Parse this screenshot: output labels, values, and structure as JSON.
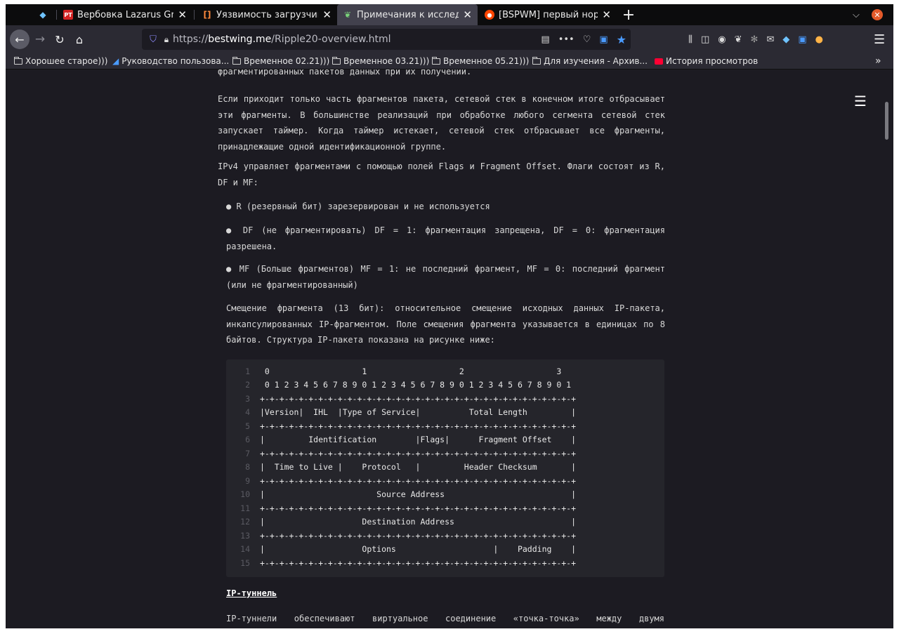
{
  "tabs": [
    {
      "label": "",
      "favicon": "sapphire-icon",
      "active": false
    },
    {
      "label": "Вербовка Lazarus Group",
      "favicon": "pt-icon",
      "active": false
    },
    {
      "label": "Уязвимость загрузчика",
      "favicon": "bracket-icon",
      "active": false
    },
    {
      "label": "Примечания к исследов",
      "favicon": "sprout-icon",
      "active": true
    },
    {
      "label": "[BSPWM] первый норд",
      "favicon": "reddit-icon",
      "active": false
    }
  ],
  "tab_close_glyph": "✕",
  "new_tab_glyph": "+",
  "address_bar": {
    "scheme": "https://",
    "host": "bestwing.me",
    "path": "/Ripple20-overview.html"
  },
  "bookmarks": [
    {
      "label": "Хорошее старое)))",
      "icon": "folder-icon"
    },
    {
      "label": "Руководство пользова...",
      "icon": "page-icon"
    },
    {
      "label": "Временное 02.21)))",
      "icon": "folder-icon"
    },
    {
      "label": "Временное 03.21)))",
      "icon": "folder-icon"
    },
    {
      "label": "Временное 05.21)))",
      "icon": "folder-icon"
    },
    {
      "label": "Для изучения - Архив...",
      "icon": "folder-icon"
    },
    {
      "label": "История просмотров",
      "icon": "youtube-icon"
    }
  ],
  "article": {
    "p0": "фрагментированных пакетов данных при их получении.",
    "p1": "Если приходит только часть фрагментов пакета, сетевой стек в конечном итоге отбрасывает эти фрагменты. В большинстве реализаций при обработке любого сегмента сетевой стек запускает таймер. Когда таймер истекает, сетевой стек отбрасывает все фрагменты, принадлежащие одной идентификационной группе.",
    "p2": "IPv4 управляет фрагментами с помощью полей Flags и Fragment Offset. Флаги состоят из R, DF и MF:",
    "b1": "● R (резервный бит) зарезервирован и не используется",
    "b2": "● DF (не фрагментировать) DF = 1: фрагментация запрещена, DF = 0: фрагментация разрешена.",
    "b3": "● MF (Больше фрагментов) MF = 1: не последний фрагмент, MF = 0: последний фрагмент (или не фрагментированный)",
    "p3": "Смещение фрагмента (13 бит): относительное смещение исходных данных IP-пакета, инкапсулированных IP-фрагментом. Поле смещения фрагмента указывается в единицах по 8 байтов. Структура IP-пакета показана на рисунке ниже:",
    "heading": "IP-туннель",
    "p4": "IP-туннели обеспечивают виртуальное соединение «точка-точка» между двумя"
  },
  "code_lines": [
    {
      "n": "1",
      "text": " 0                   1                   2                   3"
    },
    {
      "n": "2",
      "text": " 0 1 2 3 4 5 6 7 8 9 0 1 2 3 4 5 6 7 8 9 0 1 2 3 4 5 6 7 8 9 0 1"
    },
    {
      "n": "3",
      "text": "+-+-+-+-+-+-+-+-+-+-+-+-+-+-+-+-+-+-+-+-+-+-+-+-+-+-+-+-+-+-+-+-+"
    },
    {
      "n": "4",
      "text": "|Version|  IHL  |Type of Service|          Total Length         |"
    },
    {
      "n": "5",
      "text": "+-+-+-+-+-+-+-+-+-+-+-+-+-+-+-+-+-+-+-+-+-+-+-+-+-+-+-+-+-+-+-+-+"
    },
    {
      "n": "6",
      "text": "|         Identification        |Flags|      Fragment Offset    |"
    },
    {
      "n": "7",
      "text": "+-+-+-+-+-+-+-+-+-+-+-+-+-+-+-+-+-+-+-+-+-+-+-+-+-+-+-+-+-+-+-+-+"
    },
    {
      "n": "8",
      "text": "|  Time to Live |    Protocol   |         Header Checksum       |"
    },
    {
      "n": "9",
      "text": "+-+-+-+-+-+-+-+-+-+-+-+-+-+-+-+-+-+-+-+-+-+-+-+-+-+-+-+-+-+-+-+-+"
    },
    {
      "n": "10",
      "text": "|                       Source Address                          |"
    },
    {
      "n": "11",
      "text": "+-+-+-+-+-+-+-+-+-+-+-+-+-+-+-+-+-+-+-+-+-+-+-+-+-+-+-+-+-+-+-+-+"
    },
    {
      "n": "12",
      "text": "|                    Destination Address                        |"
    },
    {
      "n": "13",
      "text": "+-+-+-+-+-+-+-+-+-+-+-+-+-+-+-+-+-+-+-+-+-+-+-+-+-+-+-+-+-+-+-+-+"
    },
    {
      "n": "14",
      "text": "|                    Options                    |    Padding    |"
    },
    {
      "n": "15",
      "text": "+-+-+-+-+-+-+-+-+-+-+-+-+-+-+-+-+-+-+-+-+-+-+-+-+-+-+-+-+-+-+-+-+"
    }
  ],
  "colors": {
    "accent": "#4a9bff",
    "page_bg": "#1c1b22",
    "tab_active": "#42414d"
  }
}
